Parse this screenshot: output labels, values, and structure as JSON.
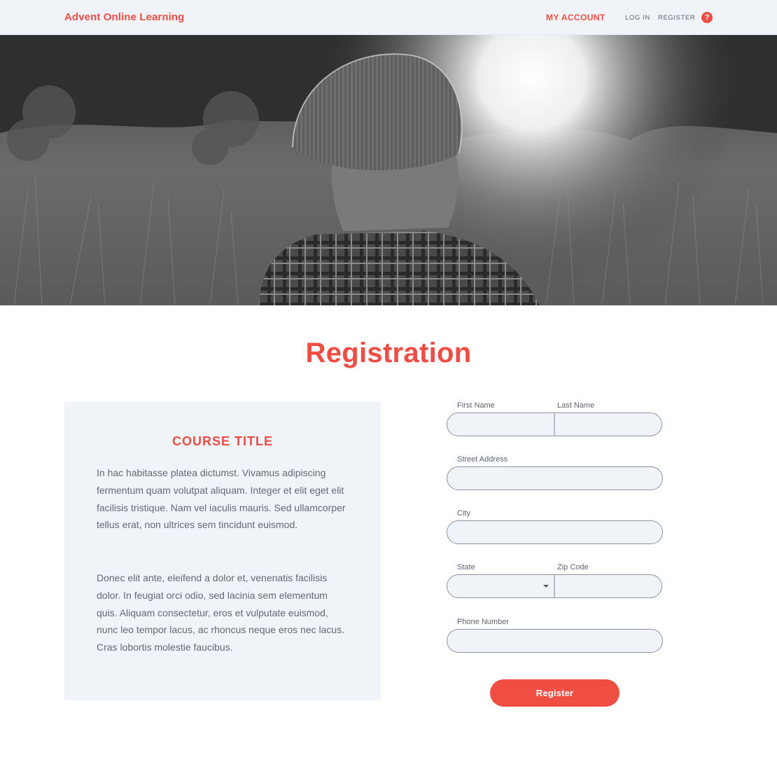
{
  "header": {
    "brand": "Advent Online Learning",
    "my_account": "MY ACCOUNT",
    "log_in": "LOG IN",
    "register": "REGISTER",
    "help_glyph": "?"
  },
  "hero": {
    "image_icon": "hero-photo"
  },
  "page": {
    "title": "Registration"
  },
  "course": {
    "title": "COURSE TITLE",
    "paragraph_1": "In hac habitasse platea dictumst. Vivamus adipiscing fermentum quam volutpat aliquam. Integer et elit eget elit facilisis tristique. Nam vel iaculis mauris. Sed ullamcorper tellus erat, non ultrices sem tincidunt euismod.",
    "paragraph_2": "Donec elit ante, eleifend a dolor et, venenatis facilisis dolor. In feugiat orci odio, sed lacinia sem elementum quis. Aliquam consectetur, eros et vulputate euismod, nunc leo tempor lacus, ac rhoncus neque eros nec lacus. Cras lobortis molestie faucibus."
  },
  "form": {
    "first_name_label": "First Name",
    "first_name_value": "",
    "last_name_label": "Last Name",
    "last_name_value": "",
    "street_label": "Street Address",
    "street_value": "",
    "city_label": "City",
    "city_value": "",
    "state_label": "State",
    "state_value": "",
    "zip_label": "Zip Code",
    "zip_value": "",
    "phone_label": "Phone Number",
    "phone_value": "",
    "submit_label": "Register"
  },
  "colors": {
    "accent": "#ef4d43",
    "header_bg": "#f0f3f8",
    "panel_bg": "#f0f3f8",
    "field_border": "#8d939e"
  }
}
